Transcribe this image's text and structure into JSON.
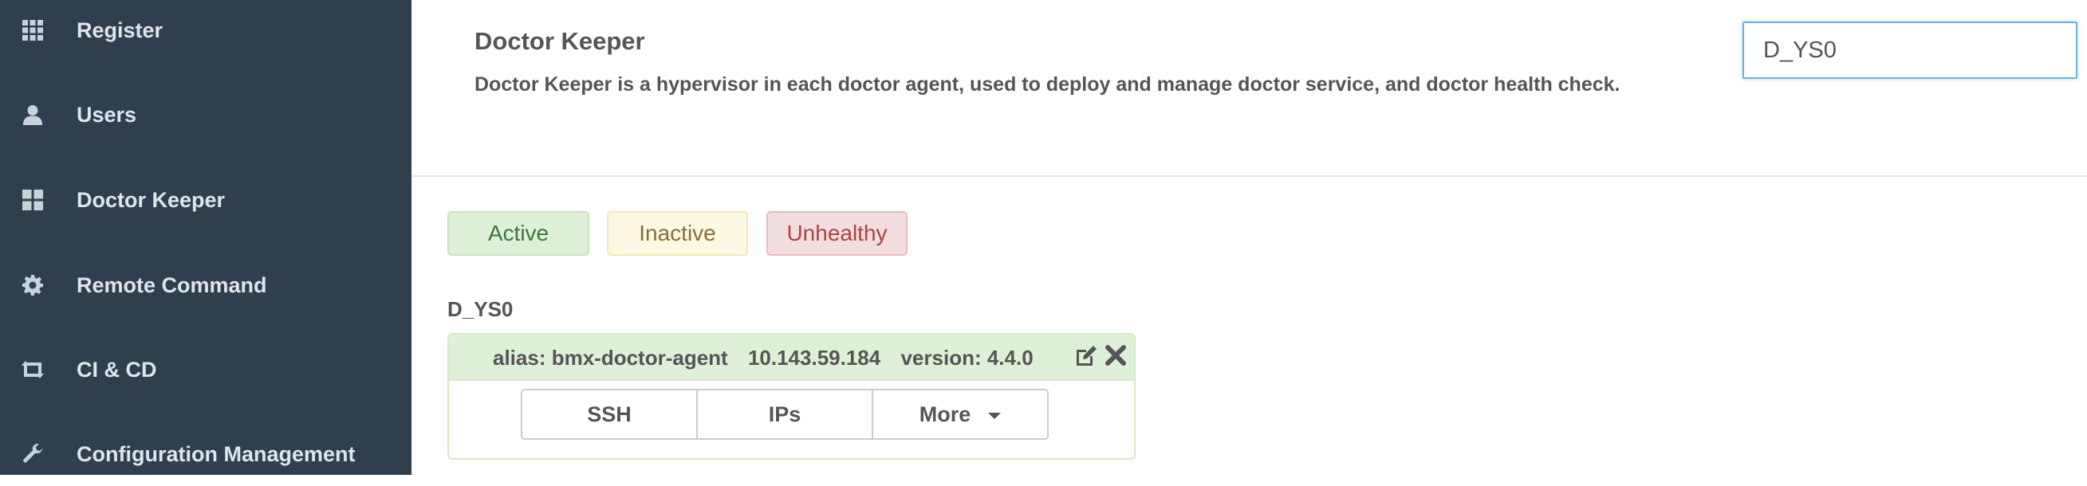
{
  "sidebar": {
    "items": [
      {
        "label": "Register",
        "icon": "grid-icon"
      },
      {
        "label": "Users",
        "icon": "user-icon"
      },
      {
        "label": "Doctor Keeper",
        "icon": "dashboard-icon"
      },
      {
        "label": "Remote Command",
        "icon": "gear-icon"
      },
      {
        "label": "CI & CD",
        "icon": "retweet-icon"
      },
      {
        "label": "Configuration Management",
        "icon": "wrench-icon"
      }
    ]
  },
  "header": {
    "title": "Doctor Keeper",
    "description": "Doctor Keeper is a hypervisor in each doctor agent, used to deploy and manage doctor service, and doctor health check.",
    "search_value": "D_YS0"
  },
  "filters": {
    "active": "Active",
    "inactive": "Inactive",
    "unhealthy": "Unhealthy"
  },
  "group": {
    "title": "D_YS0",
    "agent": {
      "alias": "alias: bmx-doctor-agent",
      "ip": "10.143.59.184",
      "version": "version: 4.4.0",
      "buttons": {
        "ssh": "SSH",
        "ips": "IPs",
        "more": "More"
      }
    }
  },
  "colors": {
    "sidebar_bg": "#2f3f4e",
    "active": "#dff0d8",
    "inactive": "#fcf8e3",
    "unhealthy": "#f2dede",
    "focus": "#66afe9"
  }
}
